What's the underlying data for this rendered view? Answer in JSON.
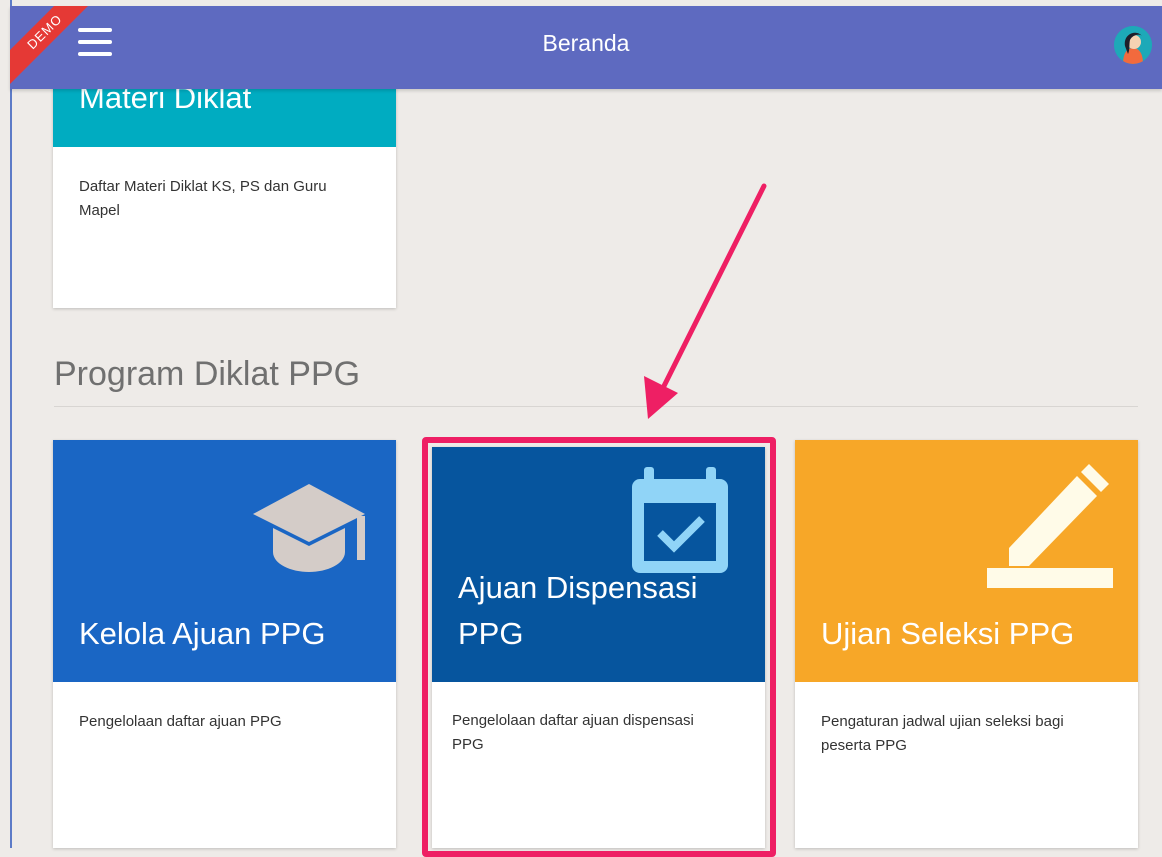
{
  "header": {
    "title": "Beranda",
    "demo_label": "DEMO"
  },
  "cards_top": [
    {
      "title": "Materi Diklat",
      "description": "Daftar Materi Diklat KS, PS dan Guru Mapel"
    }
  ],
  "section": {
    "title": "Program Diklat PPG",
    "cards": [
      {
        "title": "Kelola Ajuan PPG",
        "description": "Pengelolaan daftar ajuan PPG",
        "icon": "graduation-cap-icon",
        "color": "#1a66c4"
      },
      {
        "title": "Ajuan Dispensasi PPG",
        "description": "Pengelolaan daftar ajuan dispensasi PPG",
        "icon": "calendar-check-icon",
        "color": "#06559e"
      },
      {
        "title": "Ujian Seleksi PPG",
        "description": "Pengaturan jadwal ujian seleksi bagi peserta PPG",
        "icon": "pencil-icon",
        "color": "#f7a728"
      }
    ]
  },
  "colors": {
    "header": "#5e6ac0",
    "materi": "#00acc1",
    "highlight": "#ee1f64",
    "background": "#eeebe8"
  }
}
